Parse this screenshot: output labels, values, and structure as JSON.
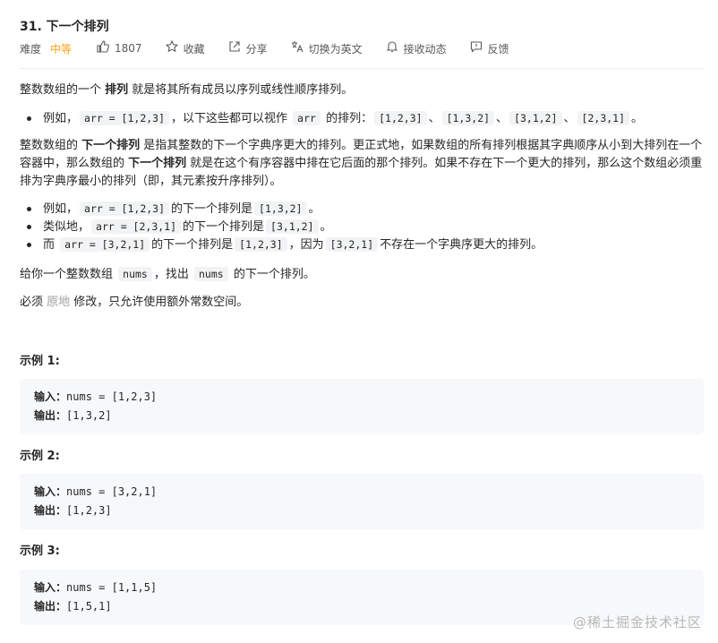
{
  "problem": {
    "title": "31. 下一个排列"
  },
  "meta": {
    "difficulty_label": "难度",
    "difficulty_value": "中等",
    "likes": "1807",
    "favorite": "收藏",
    "share": "分享",
    "translate": "切换为英文",
    "notify": "接收动态",
    "feedback": "反馈",
    "icons": [
      "thumb-up-icon",
      "star-icon",
      "share-icon",
      "translate-icon",
      "bell-icon",
      "feedback-icon"
    ],
    "accent_color": "#ffa116"
  },
  "desc": {
    "p1": {
      "a": "整数数组的一个 ",
      "b": "排列",
      "c": " 就是将其所有成员以序列或线性顺序排列。"
    },
    "b1": {
      "a": "例如，",
      "code1": "arr = [1,2,3]",
      "b": "，以下这些都可以视作 ",
      "code2": "arr",
      "c": " 的排列：",
      "c1": "[1,2,3]",
      "sep1": "、",
      "c2": "[1,3,2]",
      "sep2": "、",
      "c3": "[3,1,2]",
      "sep3": "、",
      "c4": "[2,3,1]",
      "end": "。"
    },
    "p2": {
      "a": "整数数组的 ",
      "b": "下一个排列",
      "c": " 是指其整数的下一个字典序更大的排列。更正式地，如果数组的所有排列根据其字典顺序从小到大排列在一个",
      "d": "容器中，那么数组的 ",
      "e": "下一个排列",
      "f": " 就是在这个有序容器中排在它后面的那个排列。如果不存在下一个更大的排列，那么这个数组必须重",
      "g": "排为字典序最小的排列（即，其元素按升序排列）。"
    },
    "b2": {
      "a": "例如，",
      "code1": "arr = [1,2,3]",
      "b": "的下一个排列是",
      "code2": "[1,3,2]",
      "c": "。"
    },
    "b3": {
      "a": "类似地，",
      "code1": "arr = [2,3,1]",
      "b": "的下一个排列是",
      "code2": "[3,1,2]",
      "c": "。"
    },
    "b4": {
      "a": "而 ",
      "code1": "arr = [3,2,1]",
      "b": "的下一个排列是",
      "code2": "[1,2,3]",
      "c": "，因为",
      "code3": "[3,2,1]",
      "d": "不存在一个字典序更大的排列。"
    },
    "p3": {
      "a": "给你一个整数数组 ",
      "code1": "nums",
      "b": "，找出 ",
      "code2": "nums",
      "c": " 的下一个排列。"
    },
    "p4": {
      "a": "必须 ",
      "b": "原地",
      "c": " 修改，只允许使用额外常数空间。"
    }
  },
  "examples": [
    {
      "title": "示例 1:",
      "input_label": "输入：",
      "input": "nums = [1,2,3]",
      "output_label": "输出：",
      "output": "[1,3,2]"
    },
    {
      "title": "示例 2:",
      "input_label": "输入：",
      "input": "nums = [3,2,1]",
      "output_label": "输出：",
      "output": "[1,2,3]"
    },
    {
      "title": "示例 3:",
      "input_label": "输入：",
      "input": "nums = [1,1,5]",
      "output_label": "输出：",
      "output": "[1,5,1]"
    }
  ],
  "watermark": "@稀土掘金技术社区"
}
